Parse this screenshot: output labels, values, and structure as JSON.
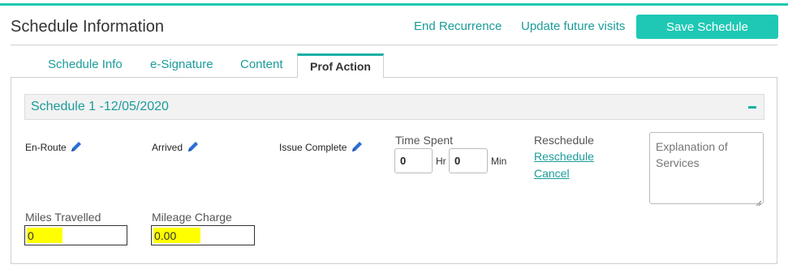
{
  "header": {
    "title": "Schedule Information",
    "end_recurrence": "End Recurrence",
    "update_future_visits": "Update future visits",
    "save_schedule": "Save Schedule"
  },
  "tabs": [
    {
      "label": "Schedule Info"
    },
    {
      "label": "e-Signature"
    },
    {
      "label": "Content"
    },
    {
      "label": "Prof Action",
      "active": true
    }
  ],
  "schedule": {
    "title": "Schedule 1 -12/05/2020",
    "collapse_icon": "minus-icon"
  },
  "actions": {
    "en_route": "En-Route",
    "arrived": "Arrived",
    "issue_complete": "Issue Complete",
    "edit_icon": "pencil-icon"
  },
  "time_spent": {
    "label": "Time Spent",
    "hours": "0",
    "hours_unit": "Hr",
    "minutes": "0",
    "minutes_unit": "Min"
  },
  "reschedule": {
    "label": "Reschedule",
    "reschedule_link": "Reschedule",
    "cancel_link": "Cancel"
  },
  "explanation": {
    "placeholder": "Explanation of Services"
  },
  "miles": {
    "label": "Miles Travelled",
    "value": "0"
  },
  "mileage_charge": {
    "label": "Mileage Charge",
    "value": "0.00"
  },
  "colors": {
    "accent": "#1ec8b4",
    "link": "#1a9c9a",
    "highlight": "#ffff00"
  }
}
